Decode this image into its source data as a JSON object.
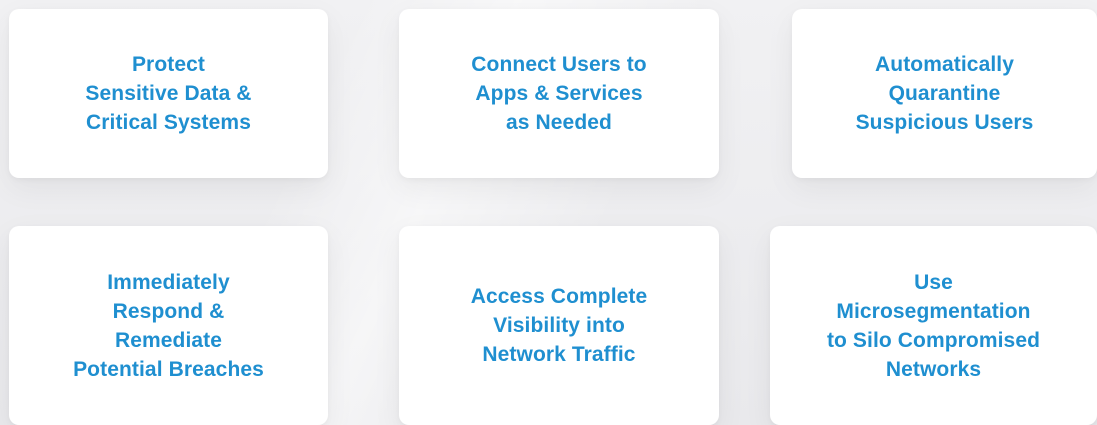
{
  "cards": [
    {
      "text": "Protect\nSensitive Data &\nCritical Systems"
    },
    {
      "text": "Connect Users to\nApps & Services\nas Needed"
    },
    {
      "text": "Automatically\nQuarantine\nSuspicious Users"
    },
    {
      "text": "Immediately\nRespond &\nRemediate\nPotential Breaches"
    },
    {
      "text": "Access Complete\nVisibility into\nNetwork Traffic"
    },
    {
      "text": "Use\nMicrosegmentation\nto Silo Compromised\nNetworks"
    }
  ],
  "colors": {
    "accent": "#1f8fd0",
    "card_background": "#ffffff",
    "page_background": "#ececee"
  }
}
